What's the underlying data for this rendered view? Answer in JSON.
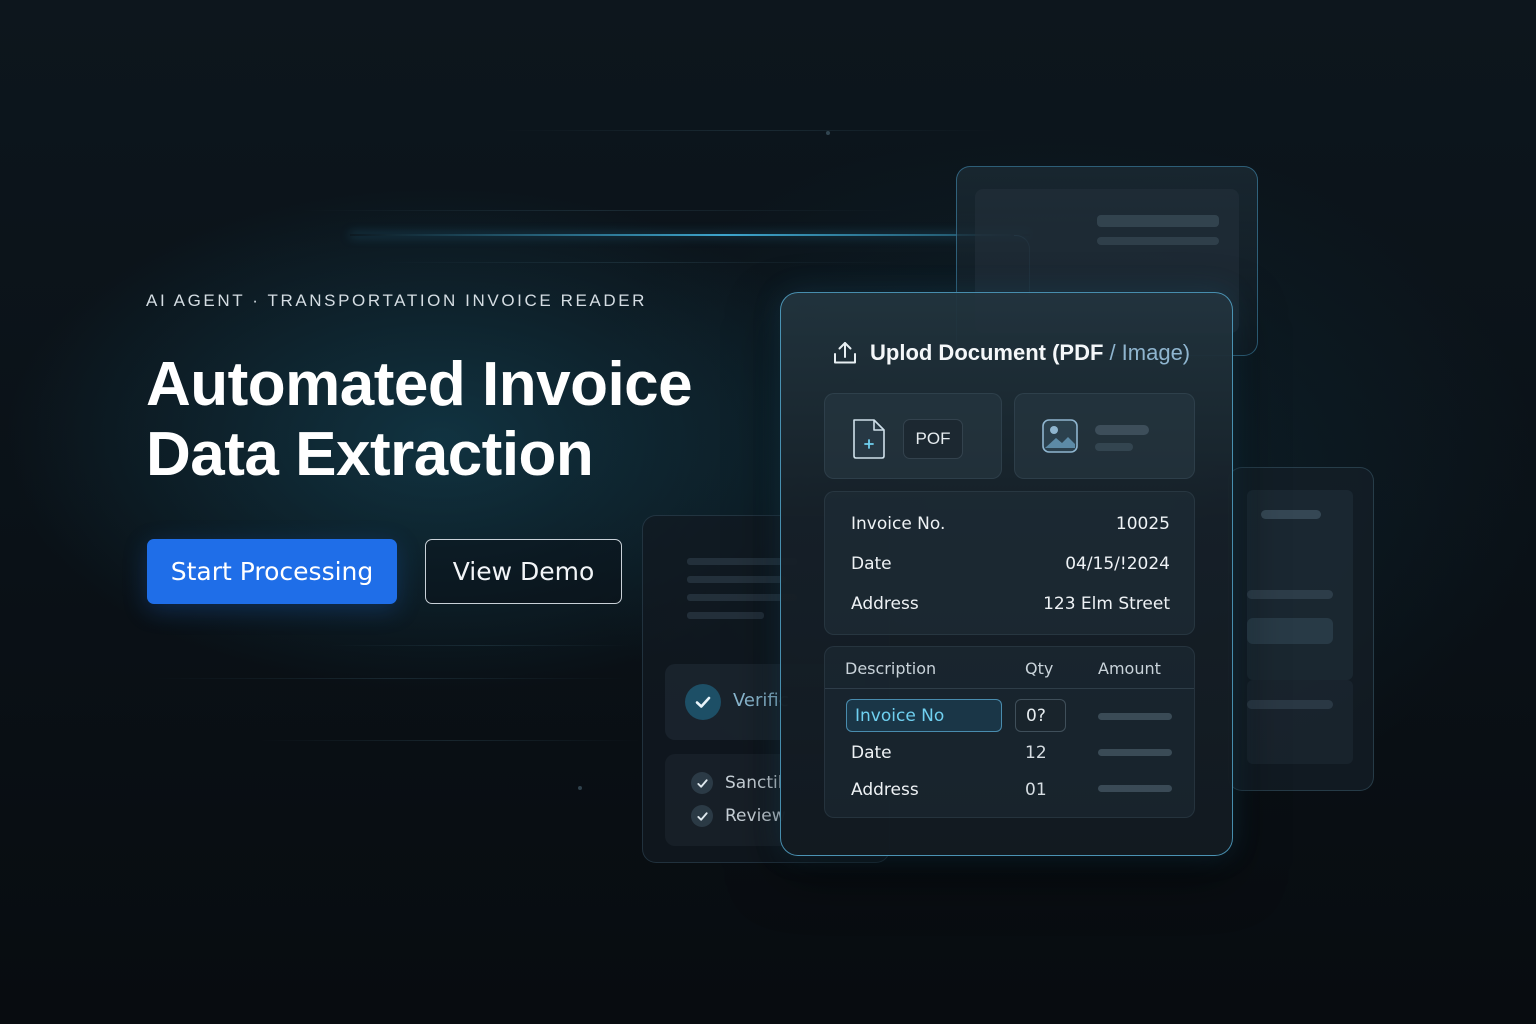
{
  "hero": {
    "eyebrow": "AI AGENT · TRANSPORTATION INVOICE READER",
    "title_line1": "Automated Invoice",
    "title_line2": "Data Extraction",
    "primary_button": "Start Processing",
    "secondary_button": "View Demo"
  },
  "upload_card": {
    "title": "Uplod Document (PDF",
    "title_suffix": "/ Image)",
    "file_types": {
      "pdf_label": "POF"
    },
    "fields": [
      {
        "label": "Invoice No.",
        "value": "10025"
      },
      {
        "label": "Date",
        "value": "04/15/!2024"
      },
      {
        "label": "Address",
        "value": "123 Elm Street"
      }
    ],
    "table": {
      "headers": {
        "description": "Description",
        "qty": "Qty",
        "amount": "Amount"
      },
      "rows": [
        {
          "description": "Invoice No",
          "qty": "0?"
        },
        {
          "description": "Date",
          "qty": "12"
        },
        {
          "description": "Address",
          "qty": "01"
        }
      ]
    }
  },
  "verification_panel": {
    "status_label": "Verific",
    "checks": [
      "Sanctil",
      "Review"
    ]
  },
  "colors": {
    "accent_primary": "#1f6ee8",
    "accent_cyan": "#6fd0f0",
    "card_border": "#5ab4dc",
    "background": "#0a1117"
  },
  "icons": [
    "upload-icon",
    "pdf-file-icon",
    "image-file-icon",
    "check-circle-icon",
    "check-icon"
  ]
}
